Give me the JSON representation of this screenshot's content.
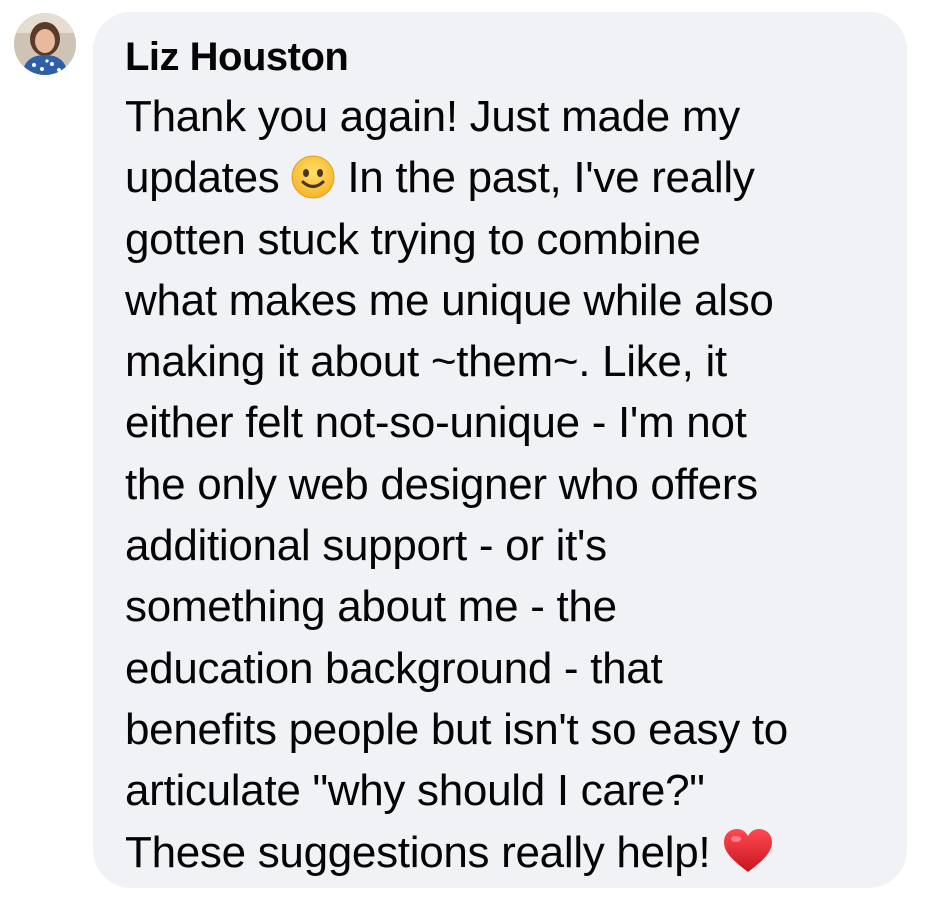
{
  "comment": {
    "author": "Liz Houston",
    "lines": [
      "Thank you again! Just made my",
      "updates",
      "In the past, I've really",
      "gotten stuck trying to combine",
      "what makes me unique while also",
      "making it about ~them~. Like, it",
      "either felt not-so-unique - I'm not",
      "the only web designer who offers",
      "additional support - or it's",
      "something about me - the",
      "education background - that",
      "benefits people but isn't so easy to",
      "articulate \"why should I care?\"",
      "These suggestions really help!"
    ],
    "emojis": {
      "smile": "slightly-smiling-face-icon",
      "heart": "red-heart-icon"
    }
  },
  "colors": {
    "bubble_bg": "#f0f2f5",
    "text": "#050505",
    "emoji_yellow": "#ffcc33",
    "heart_red": "#e0242b"
  }
}
